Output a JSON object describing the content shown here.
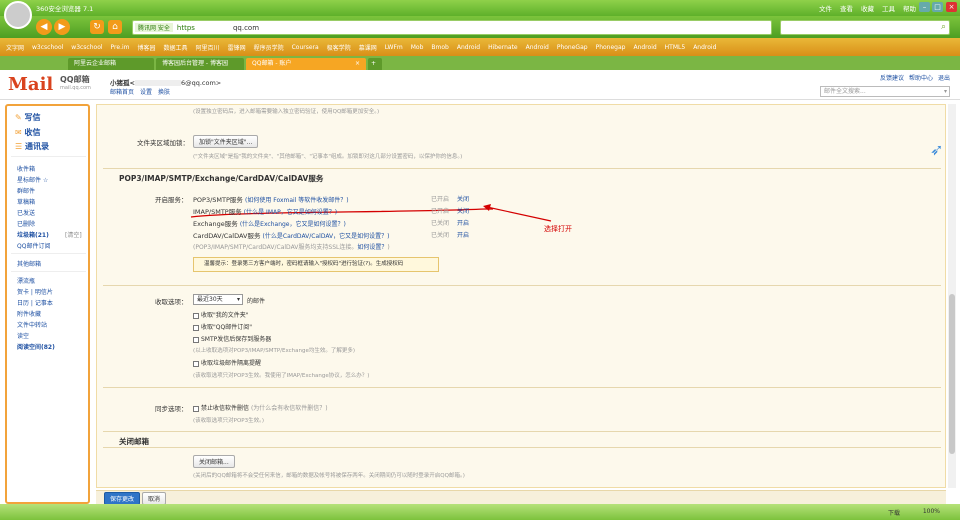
{
  "browser": {
    "title": "360安全浏览器 7.1",
    "menus": [
      "文件",
      "查看",
      "收藏",
      "工具",
      "帮助"
    ],
    "address_icon_label": "腾讯网 安全",
    "url_scheme": "https",
    "url_host": "qq.com",
    "bookmarks": [
      "文字网",
      "w3cschool",
      "w3cschool",
      "Pre.im",
      "博客园",
      "数据工具",
      "阿里百川",
      "雷锋网",
      "程序员学院",
      "Coursera",
      "极客学院",
      "慕课网",
      "LWFm",
      "Mob",
      "Bmob",
      "Android",
      "Hibernate",
      "Android",
      "PhoneGap",
      "Phonegap",
      "Android",
      "HTML5",
      "Android"
    ],
    "tabs": [
      {
        "label": "阿里云企业邮箱",
        "active": false
      },
      {
        "label": "博客园后台管理 - 博客园",
        "active": false
      },
      {
        "label": "QQ邮箱 - 账户",
        "active": true
      }
    ]
  },
  "mail_header": {
    "brand": "QQ邮箱",
    "domain": "mail.qq.com",
    "username_prefix": "小猪孤<",
    "username_suffix": "6@qq.com>",
    "links": [
      "邮箱首页",
      "设置",
      "换肤"
    ],
    "top_links": [
      "反馈建议",
      "帮助中心",
      "退出"
    ],
    "search_placeholder": "邮件全文搜索..."
  },
  "sidebar": {
    "actions": [
      "写信",
      "收信",
      "通讯录"
    ],
    "folders": [
      "收件箱",
      "星标邮件 ☆",
      "群邮件",
      "草稿箱",
      "已发送",
      "已删除",
      "垃圾箱(21)",
      "QQ邮件订阅"
    ],
    "spam_clear": "[清空]",
    "other": "其他邮箱",
    "tools": [
      "漂流瓶",
      "贺卡 | 明信片",
      "日历 | 记事本",
      "附件收藏",
      "文件中转站",
      "读空",
      "阅读空间(82)"
    ]
  },
  "settings": {
    "top_note": "(设置独立密码后，进入邮箱需要输入独立密码验证，使用QQ邮箱更加安全。)",
    "folder_area_label": "文件夹区域加锁：",
    "folder_area_button": "加锁\"文件夹区域\"...",
    "folder_area_note": "(\"文件夹区域\"是指\"我的文件夹\"、\"其他邮箱\"、\"记事本\"组成。加锁即对这几部分设置密码，以保护你的信息。)",
    "pop_section_title": "POP3/IMAP/SMTP/Exchange/CardDAV/CalDAV服务",
    "enable_label": "开启服务：",
    "services": [
      {
        "name": "POP3/SMTP服务",
        "hint": "(如何使用 Foxmail 等软件收发邮件？)",
        "status": "已开启",
        "action": "关闭"
      },
      {
        "name": "IMAP/SMTP服务",
        "hint": "(什么是 IMAP，它又是如何设置？)",
        "status": "已开启",
        "action": "关闭"
      },
      {
        "name": "Exchange服务",
        "hint": "(什么是Exchange，它又是如何设置？)",
        "status": "已关闭",
        "action": "开启"
      },
      {
        "name": "CardDAV/CalDAV服务",
        "hint": "(什么是CardDAV/CalDAV，它又是如何设置？)",
        "status": "已关闭",
        "action": "开启"
      }
    ],
    "ssl_note_prefix": "(POP3/IMAP/SMTP/CardDAV/CalDAV服务均支持SSL连接。",
    "ssl_note_link": "如何设置？",
    "ssl_note_suffix": ")",
    "tip_text": "温馨提示：登录第三方客户端时，密码框请输入\"授权码\"进行验证(?)。生成授权码",
    "annotation": "选择打开",
    "receive_label": "收取选项：",
    "receive_range": "最近30天",
    "receive_suffix": "的邮件",
    "receive_options": [
      "收取\"我的文件夹\"",
      "收取\"QQ邮件订阅\"",
      "SMTP发信后保存到服务器",
      "收取垃圾邮件隔离提醒"
    ],
    "receive_note1": "(以上收取选项对POP3/IMAP/SMTP/Exchange均生效。了解更多)",
    "receive_note2": "(该收取选项只对POP3生效。我使用了IMAP/Exchange协议，怎么办？)",
    "sync_label": "同步选项：",
    "sync_option": "禁止收信软件删信",
    "sync_hint": "(为什么会有收信软件删信？)",
    "sync_note": "(该收取选项只对POP3生效。)",
    "close_title": "关闭邮箱",
    "close_button": "关闭邮箱...",
    "close_note": "(关闭后的QQ邮箱将不会受任何来信，邮箱的数据及帐号将被保存两年。关闭期间仍可以随时登录开启QQ邮箱。)",
    "save_button": "保存更改",
    "cancel_button": "取消"
  },
  "statusbar": {
    "items": [
      "下载",
      "100%"
    ]
  },
  "colors": {
    "accent_orange": "#f2a33b",
    "red_annotation": "#d40000",
    "link_blue": "#1e50a2"
  }
}
